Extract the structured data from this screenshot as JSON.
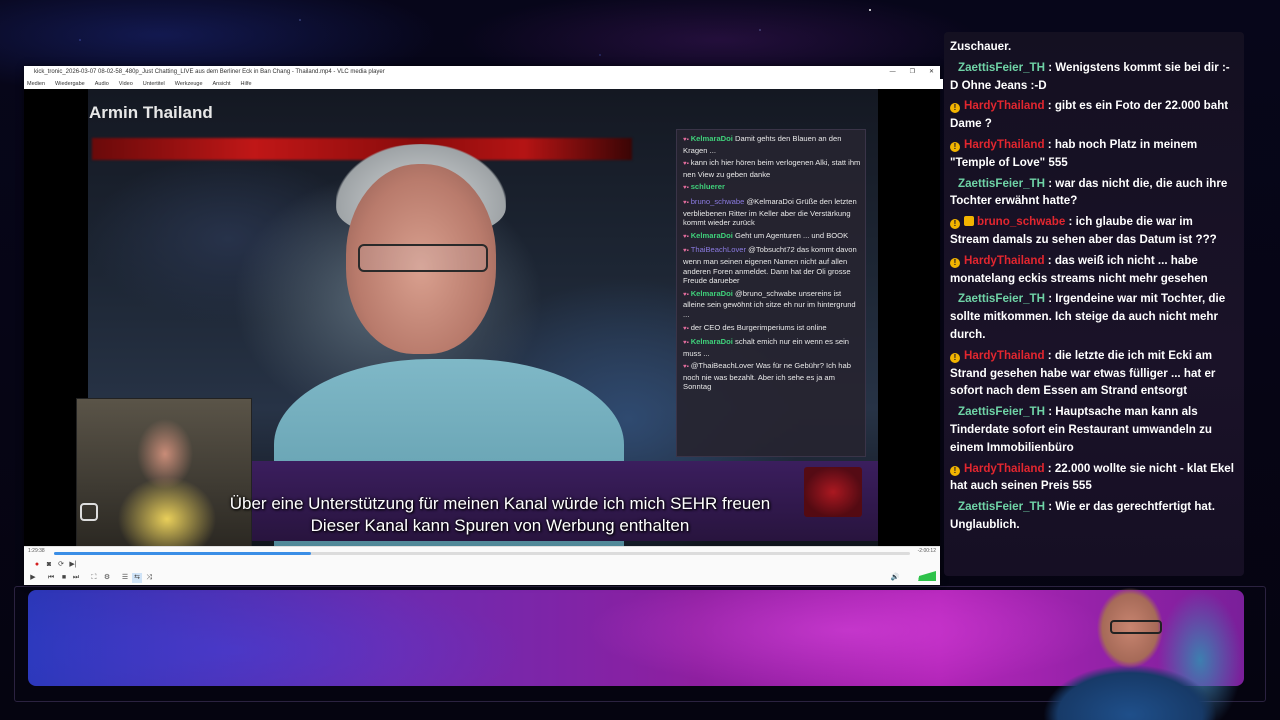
{
  "vlc": {
    "title": "kick_tronic_2026-03-07 08-02-58_480p_Just Chatting_LIVE aus dem Berliner Eck in Ban Chang - Thailand.mp4 - VLC media player",
    "menu": [
      "Medien",
      "Wiedergabe",
      "Audio",
      "Video",
      "Untertitel",
      "Werkzeuge",
      "Ansicht",
      "Hilfe"
    ],
    "window_controls": [
      "—",
      "❐",
      "✕"
    ],
    "time_elapsed": "1:29:38",
    "time_remaining": "-2:00:12",
    "progress": 0.3,
    "volume": 1.0,
    "buttons": {
      "record": "●",
      "snapshot": "◙",
      "loop": "⟳",
      "frame": "▶|",
      "play": "▶",
      "prev": "⏮",
      "stop": "■",
      "next": "⏭",
      "fullscreen": "⛶",
      "extended": "⚙",
      "playlist": "☰",
      "loopab": "⇆",
      "shuffle": "⤨",
      "mute": "🔊"
    }
  },
  "video": {
    "streamer_name": "Armin Thailand",
    "subtitle_line1": "Über eine Unterstützung für meinen Kanal würde ich mich SEHR freuen",
    "subtitle_line2": "Dieser Kanal kann Spuren von Werbung enthalten",
    "inner_chat": [
      {
        "user": "KelmaraDoi",
        "cls": "u",
        "text": "Damit gehts den Blauen an den Kragen ..."
      },
      {
        "user": "",
        "cls": "u2",
        "text": "kann ich hier hören beim verlogenen Alki, statt ihm nen View zu geben danke"
      },
      {
        "user": "schluerer",
        "cls": "u",
        "text": ""
      },
      {
        "user": "bruno_schwabe",
        "cls": "u2",
        "text": "@KelmaraDoi Grüße den letzten verbliebenen Ritter im Keller aber die Verstärkung kommt wieder zurück"
      },
      {
        "user": "KelmaraDoi",
        "cls": "u",
        "text": "Geht um Agenturen ... und BOOK"
      },
      {
        "user": "ThaiBeachLover",
        "cls": "u2",
        "text": "@Tobsucht72 das kommt davon wenn man seinen eigenen Namen nicht auf allen anderen Foren anmeldet. Dann hat der Oli grosse Freude darueber"
      },
      {
        "user": "KelmaraDoi",
        "cls": "u",
        "text": "@bruno_schwabe unsereins ist alleine sein gewöhnt ich sitze eh nur im hintergrund ..."
      },
      {
        "user": "",
        "cls": "u3",
        "text": "der CEO des Burgerimperiums ist online"
      },
      {
        "user": "KelmaraDoi",
        "cls": "u",
        "text": "schalt emich nur ein wenn es sein muss ..."
      },
      {
        "user": "",
        "cls": "u3",
        "text": "@ThaiBeachLover Was für ne Gebühr? Ich hab noch nie was bezahlt. Aber ich sehe es ja am Sonntag"
      }
    ]
  },
  "chat": {
    "messages": [
      {
        "name": "",
        "badge": false,
        "text": "Zuschauer."
      },
      {
        "name": "ZaettisFeier_TH",
        "badge": false,
        "cls": "name-z",
        "text": "Wenigstens kommt sie bei dir :-D Ohne Jeans :-D"
      },
      {
        "name": "HardyThailand",
        "badge": true,
        "cls": "name-h",
        "text": "gibt es ein Foto der 22.000 baht Dame ?"
      },
      {
        "name": "HardyThailand",
        "badge": true,
        "cls": "name-h",
        "text": "hab noch Platz in meinem \"Temple of Love\" 555"
      },
      {
        "name": "ZaettisFeier_TH",
        "badge": false,
        "cls": "name-z",
        "text": "war das nicht die, die auch ihre Tochter erwähnt hatte?"
      },
      {
        "name": "bruno_schwabe",
        "badge": true,
        "badge2": true,
        "cls": "name-b",
        "text": "ich glaube die war im Stream damals zu sehen aber das Datum ist ???"
      },
      {
        "name": "HardyThailand",
        "badge": true,
        "cls": "name-h",
        "text": "das weiß ich nicht ... habe monatelang eckis streams nicht mehr gesehen"
      },
      {
        "name": "ZaettisFeier_TH",
        "badge": false,
        "cls": "name-z",
        "text": "Irgendeine war mit Tochter, die sollte mitkommen. Ich steige da auch nicht mehr durch."
      },
      {
        "name": "HardyThailand",
        "badge": true,
        "cls": "name-h",
        "text": "die letzte die ich mit Ecki am Strand gesehen habe war etwas fülliger ... hat er sofort nach dem Essen am Strand entsorgt"
      },
      {
        "name": "ZaettisFeier_TH",
        "badge": false,
        "cls": "name-z",
        "text": "Hauptsache man kann als Tinderdate sofort ein Restaurant umwandeln zu einem Immobilienbüro"
      },
      {
        "name": "HardyThailand",
        "badge": true,
        "cls": "name-h",
        "text": "22.000 wollte sie nicht - klat Ekel hat auch seinen Preis 555"
      },
      {
        "name": "ZaettisFeier_TH",
        "badge": false,
        "cls": "name-z",
        "text": "Wie er das gerechtfertigt hat. Unglaublich."
      }
    ]
  }
}
